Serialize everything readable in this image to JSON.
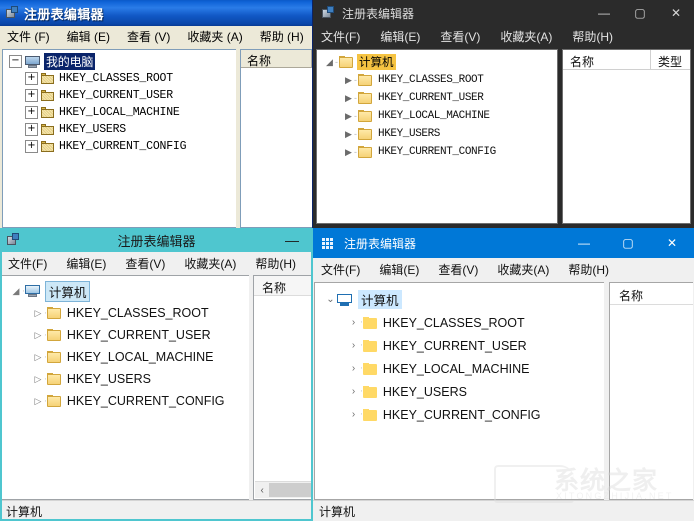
{
  "common": {
    "menu": [
      "文件(F)",
      "编辑(E)",
      "查看(V)",
      "收藏夹(A)",
      "帮助(H)"
    ],
    "menu_xp": [
      "文件 (F)",
      "编辑 (E)",
      "查看 (V)",
      "收藏夹 (A)",
      "帮助 (H)"
    ],
    "menu_dark": [
      "文件(F)",
      "编辑(E)",
      "查看(V)",
      "收藏夹(A)",
      "帮助(H)"
    ],
    "title": "注册表编辑器",
    "col_name": "名称",
    "col_type": "类型",
    "status": "计算机",
    "hkeys": [
      "HKEY_CLASSES_ROOT",
      "HKEY_CURRENT_USER",
      "HKEY_LOCAL_MACHINE",
      "HKEY_USERS",
      "HKEY_CURRENT_CONFIG"
    ]
  },
  "win_xp": {
    "title": "注册表编辑器",
    "root_label": "我的电脑",
    "root_expander": "−",
    "child_expander": "+",
    "col_name": "名称",
    "accent": "#0a46a8",
    "menu": [
      "文件 (F)",
      "编辑 (E)",
      "查看 (V)",
      "收藏夹 (A)",
      "帮助 (H)"
    ],
    "hkeys": [
      "HKEY_CLASSES_ROOT",
      "HKEY_CURRENT_USER",
      "HKEY_LOCAL_MACHINE",
      "HKEY_USERS",
      "HKEY_CURRENT_CONFIG"
    ]
  },
  "win_dark": {
    "title": "注册表编辑器",
    "root_label": "计算机",
    "root_expander": "◢",
    "child_expander": "▶",
    "col_name": "名称",
    "col_type": "类型",
    "accent": "#2b2b2b",
    "highlight": "#f5c342",
    "buttons": {
      "minimize": "—",
      "maximize": "▢",
      "close": "✕"
    },
    "menu": [
      "文件(F)",
      "编辑(E)",
      "查看(V)",
      "收藏夹(A)",
      "帮助(H)"
    ],
    "hkeys": [
      "HKEY_CLASSES_ROOT",
      "HKEY_CURRENT_USER",
      "HKEY_LOCAL_MACHINE",
      "HKEY_USERS",
      "HKEY_CURRENT_CONFIG"
    ]
  },
  "win_w8": {
    "title": "注册表编辑器",
    "root_label": "计算机",
    "root_expander": "◢",
    "child_expander": "▷",
    "col_name": "名称",
    "status": "计算机",
    "accent": "#4fc6cf",
    "buttons": {
      "minimize": "—"
    },
    "scroll_left_arrow": "‹",
    "menu": [
      "文件(F)",
      "编辑(E)",
      "查看(V)",
      "收藏夹(A)",
      "帮助(H)"
    ],
    "hkeys": [
      "HKEY_CLASSES_ROOT",
      "HKEY_CURRENT_USER",
      "HKEY_LOCAL_MACHINE",
      "HKEY_USERS",
      "HKEY_CURRENT_CONFIG"
    ]
  },
  "win_w10": {
    "title": "注册表编辑器",
    "root_label": "计算机",
    "root_expander": "⌄",
    "child_expander": "›",
    "col_name": "名称",
    "status": "计算机",
    "accent": "#0078d7",
    "buttons": {
      "minimize": "—",
      "maximize": "▢",
      "close": "✕"
    },
    "menu": [
      "文件(F)",
      "编辑(E)",
      "查看(V)",
      "收藏夹(A)",
      "帮助(H)"
    ],
    "hkeys": [
      "HKEY_CLASSES_ROOT",
      "HKEY_CURRENT_USER",
      "HKEY_LOCAL_MACHINE",
      "HKEY_USERS",
      "HKEY_CURRENT_CONFIG"
    ]
  },
  "watermark": {
    "text": "系统之家",
    "subtext": "XITONGZHIJIA.NET"
  }
}
